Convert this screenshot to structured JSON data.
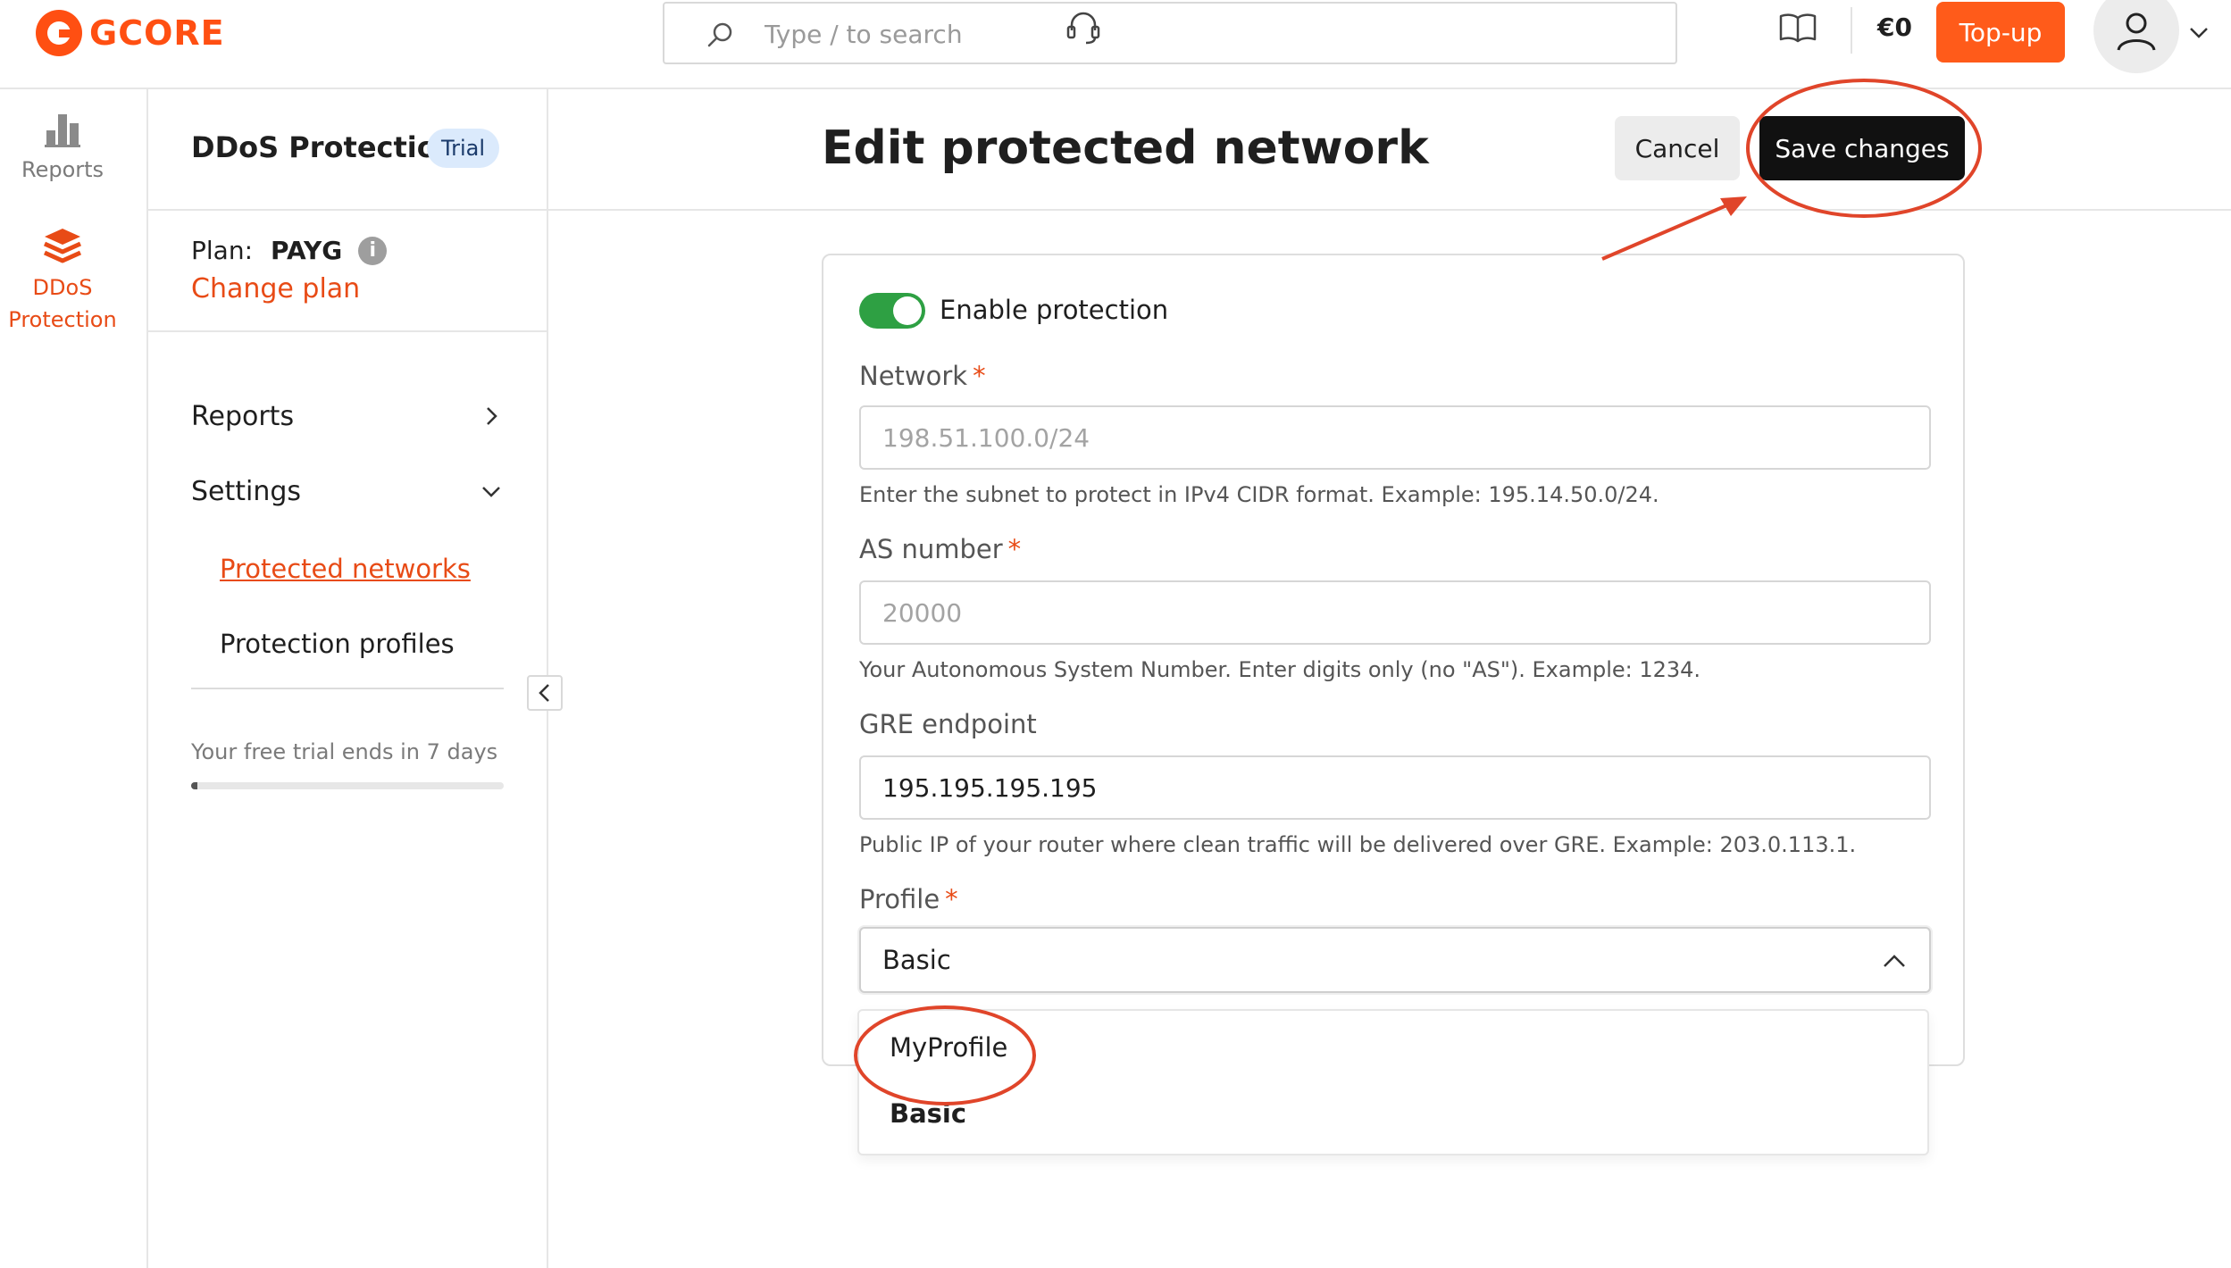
{
  "brand": {
    "name": "GCORE",
    "color": "#ff4f12"
  },
  "topbar": {
    "search_placeholder": "Type / to search",
    "icons": [
      "search-icon",
      "headset-icon",
      "book-icon",
      "user-icon",
      "chevron-down-icon"
    ],
    "balance": "€0",
    "topup_label": "Top-up"
  },
  "rail": {
    "items": [
      {
        "label": "Reports",
        "icon": "bar-chart-icon",
        "active": false
      },
      {
        "label": "DDoS Protection",
        "icon": "layers-icon",
        "active": true
      }
    ]
  },
  "sidebar": {
    "title": "DDoS Protection",
    "badge": "Trial",
    "plan_label": "Plan:",
    "plan_value": "PAYG",
    "change_plan": "Change plan",
    "nav": {
      "reports": "Reports",
      "settings": "Settings",
      "protected_networks": "Protected networks",
      "protection_profiles": "Protection profiles"
    },
    "trial_text": "Your free trial ends in 7 days",
    "trial_progress": 0.02
  },
  "main": {
    "title": "Edit protected network",
    "cancel_label": "Cancel",
    "save_label": "Save changes"
  },
  "form": {
    "enable_protection_label": "Enable protection",
    "enable_protection_on": true,
    "network": {
      "label": "Network",
      "required": "*",
      "placeholder": "198.51.100.0/24",
      "value": "",
      "help": "Enter the subnet to protect in IPv4 CIDR format. Example: 195.14.50.0/24."
    },
    "as_number": {
      "label": "AS number",
      "required": "*",
      "placeholder": "20000",
      "value": "",
      "help": "Your Autonomous System Number. Enter digits only (no \"AS\"). Example: 1234."
    },
    "gre_endpoint": {
      "label": "GRE endpoint",
      "value": "195.195.195.195",
      "help": "Public IP of your router where clean traffic will be delivered over GRE. Example: 203.0.113.1."
    },
    "profile": {
      "label": "Profile",
      "required": "*",
      "selected": "Basic",
      "options": [
        "MyProfile",
        "Basic"
      ]
    }
  },
  "colors": {
    "accent": "#e84b16",
    "toggle_on": "#2ea043",
    "primary_button": "#111111",
    "annotation": "#e0452a"
  }
}
